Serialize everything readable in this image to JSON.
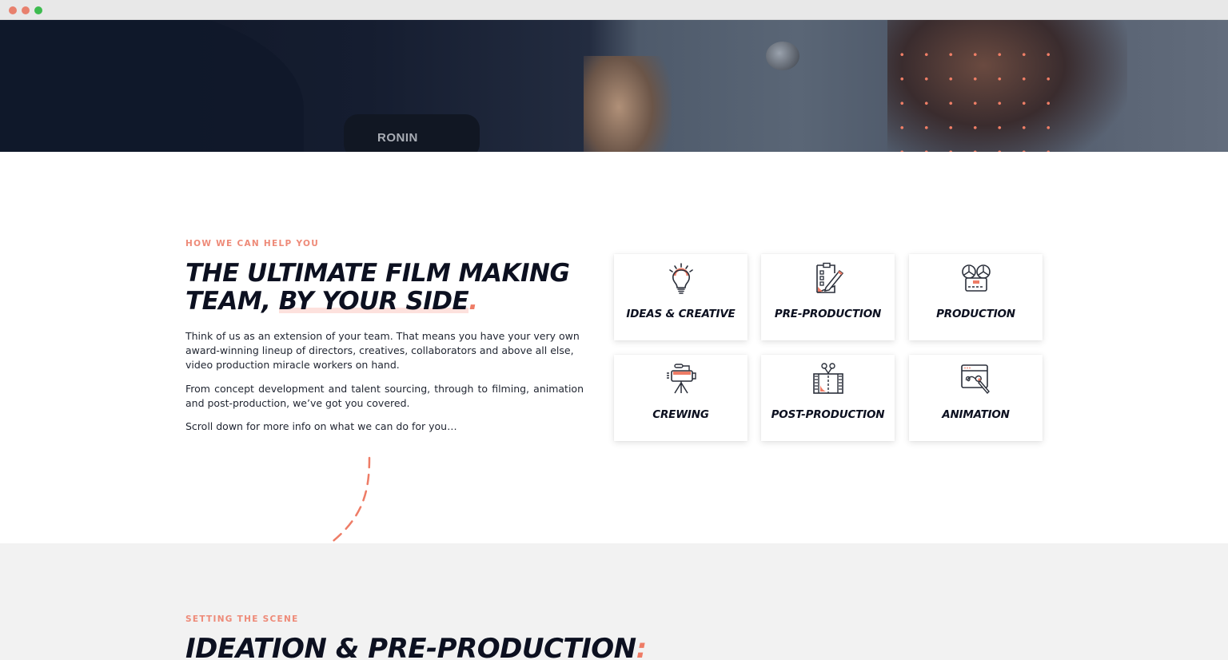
{
  "browser": {
    "window_controls": [
      "close",
      "minimize",
      "maximize"
    ]
  },
  "hero": {
    "camera_brand_text": "RONIN",
    "accent_dot_color": "#ef7e66"
  },
  "intro": {
    "eyebrow": "HOW WE CAN HELP YOU",
    "title_line1": "THE ULTIMATE FILM MAKING",
    "title_line2_prefix": "TEAM, ",
    "title_line2_highlight": "BY YOUR SIDE",
    "title_period": ".",
    "paragraphs": [
      "Think of us as an extension of your team. That means you have your very own award-winning lineup of directors, creatives, collaborators and above all else, video production miracle workers on hand.",
      "From concept development and talent sourcing, through to filming, animation and  post-production, we’ve got you covered.",
      "Scroll down for more info on what we can do for you…"
    ]
  },
  "services": [
    {
      "label": "IDEAS & CREATIVE",
      "icon": "lightbulb-icon"
    },
    {
      "label": "PRE-PRODUCTION",
      "icon": "clipboard-pencil-icon"
    },
    {
      "label": "PRODUCTION",
      "icon": "reel-to-reel-icon"
    },
    {
      "label": "CREWING",
      "icon": "camera-tripod-icon"
    },
    {
      "label": "POST-PRODUCTION",
      "icon": "film-scissors-icon"
    },
    {
      "label": "ANIMATION",
      "icon": "browser-brush-icon"
    }
  ],
  "next_section": {
    "eyebrow": "SETTING THE SCENE",
    "title": "IDEATION & PRE-PRODUCTION",
    "title_punct": ":"
  },
  "colors": {
    "accent": "#ee7c66",
    "heading": "#0c1020",
    "section_bg": "#f2f2f2",
    "highlight": "#fde1dd"
  }
}
